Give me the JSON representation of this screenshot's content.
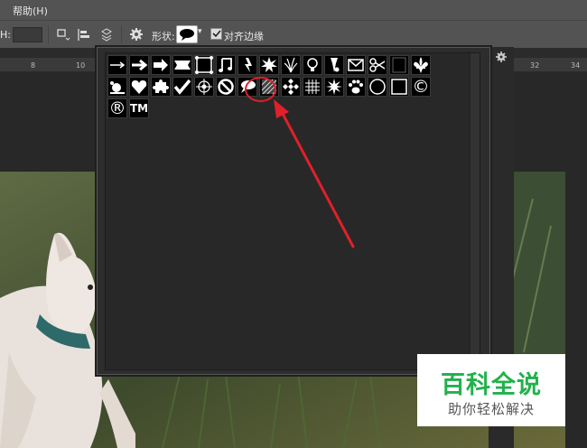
{
  "menubar": {
    "help_label": "帮助(H)"
  },
  "options": {
    "shape_label": "形状:",
    "align_edges_label": "对齐边缘",
    "align_edges_checked": true,
    "field_prefix": "H:"
  },
  "ruler": {
    "ticks": [
      "8",
      "10",
      "32",
      "34"
    ]
  },
  "shape_picker": {
    "selected": "speech-bubble",
    "row1": [
      "arrow-thin",
      "arrow-bold",
      "arrow-heavy",
      "banner",
      "frame",
      "music-notes",
      "lightning",
      "starburst",
      "grass",
      "lightbulb",
      "pin",
      "envelope",
      "scissors",
      "blank-square",
      "fleur-de-lis"
    ],
    "row2": [
      "snail",
      "heart",
      "puzzle",
      "checkmark",
      "target",
      "no-sign",
      "speech-bubble",
      "hatched-square",
      "diamond-grid",
      "grid",
      "burst",
      "paw-print",
      "circle",
      "square",
      "copyright"
    ],
    "row3": [
      "registered",
      "trademark"
    ],
    "trademark_text": "TM",
    "copyright_text": "©",
    "registered_text": "®"
  },
  "watermark": {
    "title": "百科全说",
    "subtitle": "助你轻松解决"
  },
  "colors": {
    "highlight": "#e0202a",
    "watermark_green": "#22b14c"
  }
}
